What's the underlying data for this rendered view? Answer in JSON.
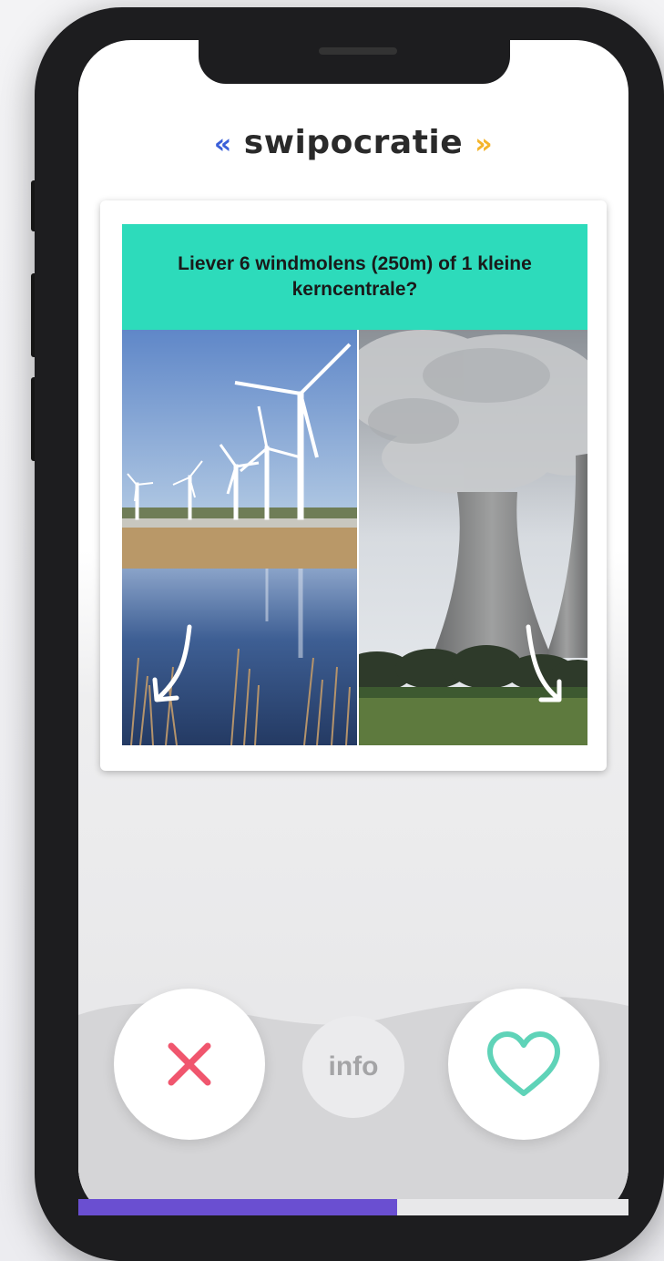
{
  "app": {
    "title": "swipocratie",
    "quote_left": "«",
    "quote_right": "»"
  },
  "card": {
    "question": "Liever 6 windmolens (250m) of 1 kleine kerncentrale?",
    "left_image": "wind-turbines-photo",
    "right_image": "nuclear-plant-photo"
  },
  "actions": {
    "reject_icon": "x-icon",
    "info_label": "info",
    "like_icon": "heart-icon"
  },
  "progress": {
    "value": 0.58
  },
  "colors": {
    "accent_teal": "#2ddbbb",
    "reject_red": "#f0566e",
    "like_teal": "#5fd3b8",
    "progress_purple": "#6a4fd1",
    "quote_blue": "#3a5fd9",
    "quote_yellow": "#f4b42a"
  }
}
